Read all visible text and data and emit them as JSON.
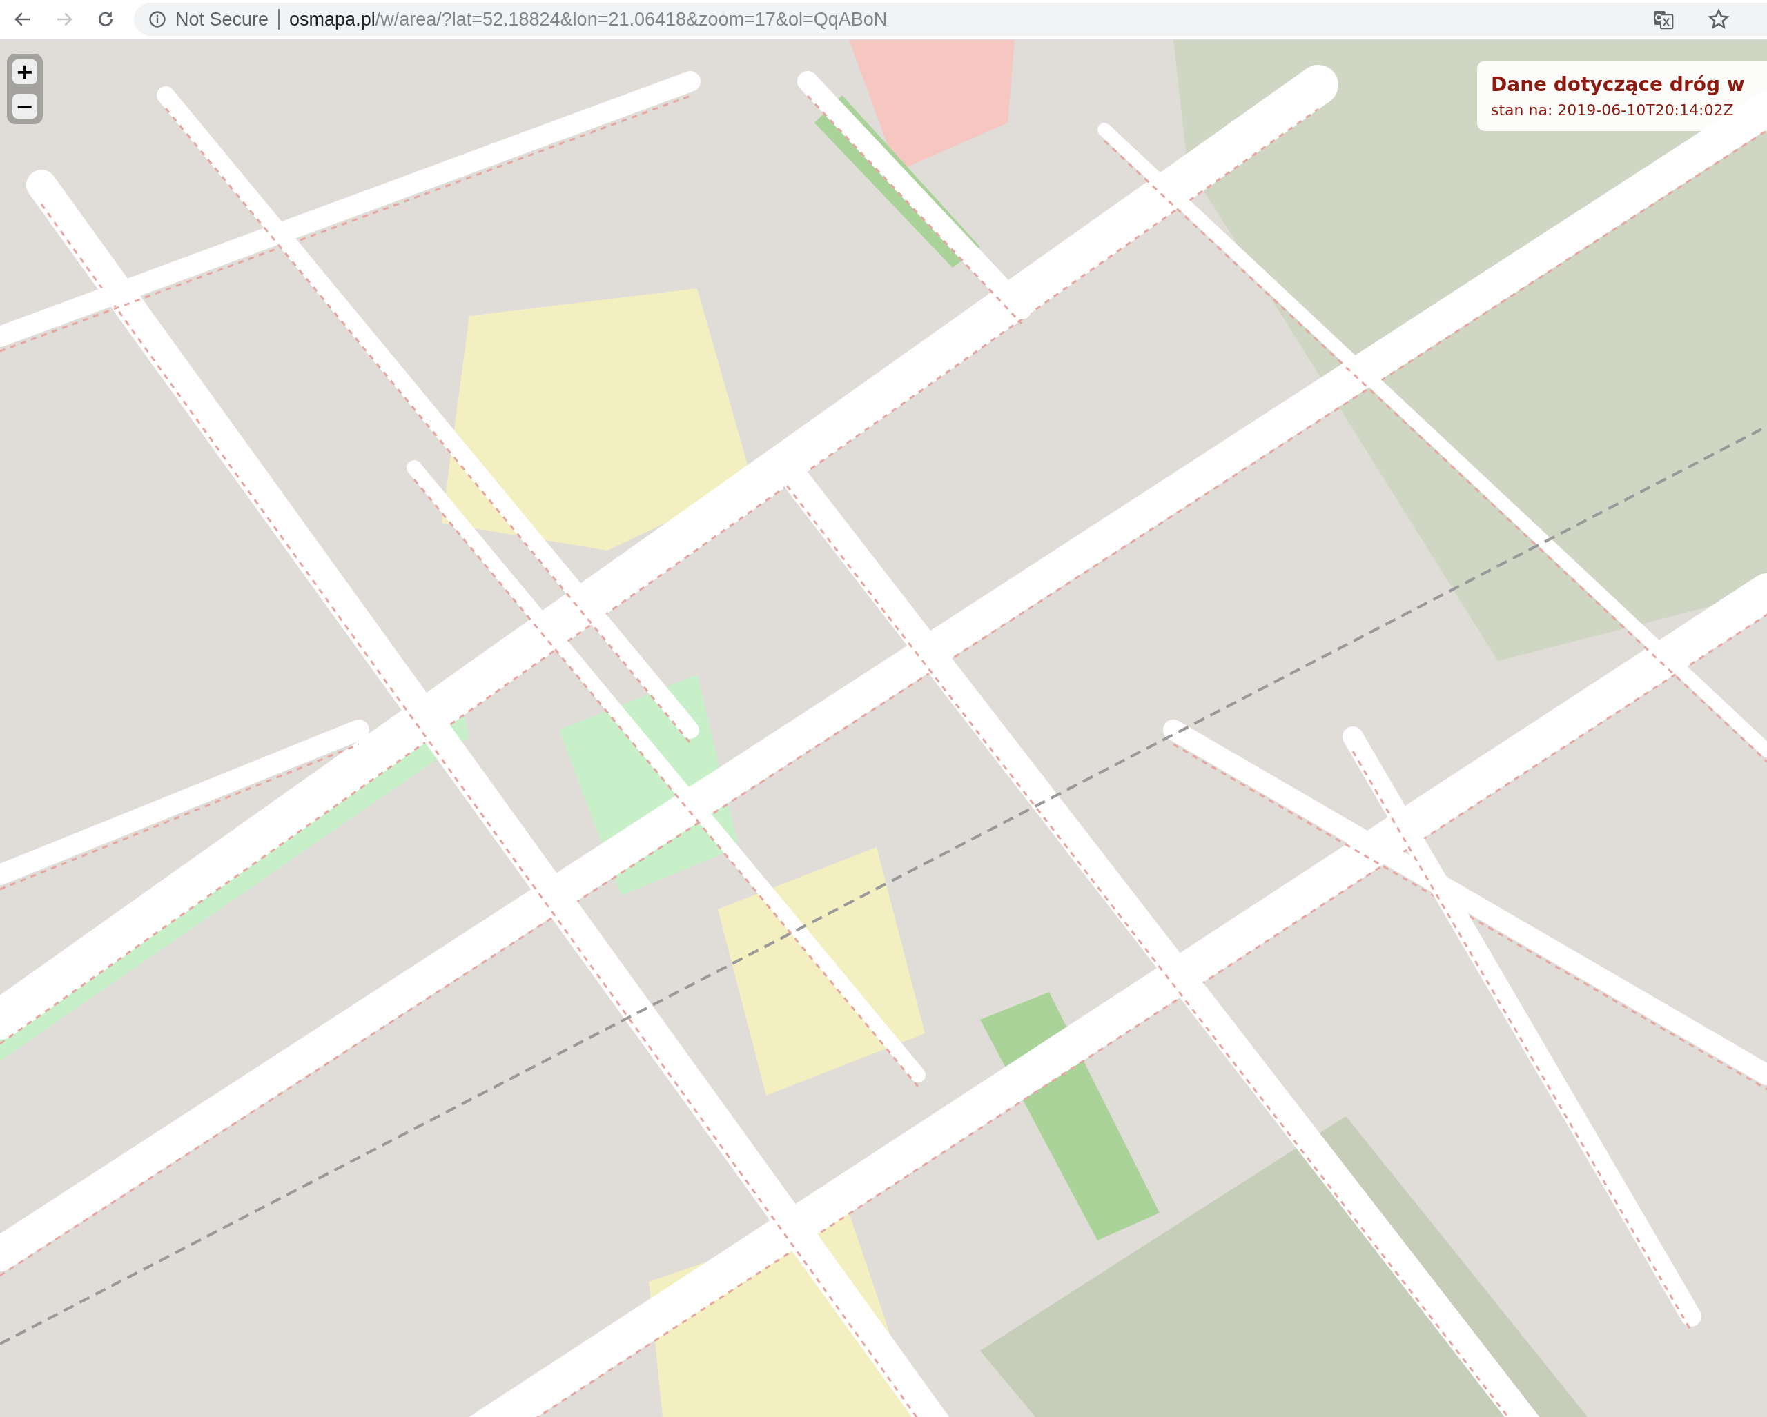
{
  "toolbar": {
    "back_enabled": true,
    "forward_enabled": false,
    "security": "Not Secure",
    "url_host": "osmapa.pl",
    "url_path": "/w/area/?lat=52.18824&lon=21.06418&zoom=17&ol=QqABoN"
  },
  "map": {
    "zoom_in": "+",
    "zoom_out": "−",
    "info_panel": {
      "title": "Dane dotyczące dróg w",
      "subtitle": "stan na: 2019-06-10T20:14:02Z"
    }
  }
}
